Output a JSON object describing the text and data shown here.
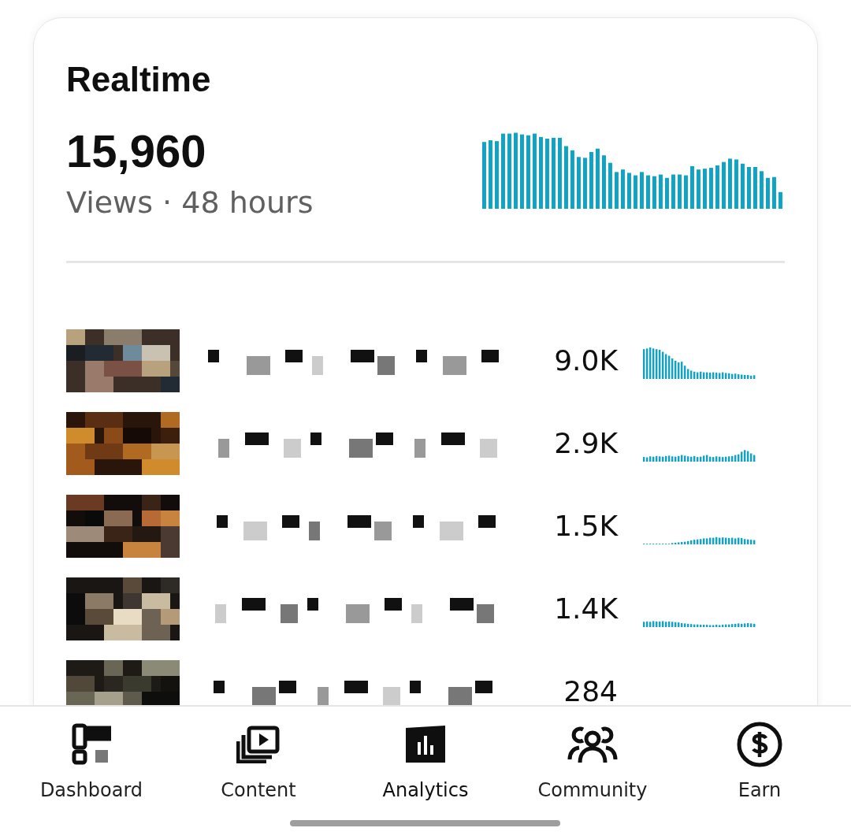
{
  "card": {
    "title": "Realtime",
    "total": "15,960",
    "caption": "Views · 48 hours"
  },
  "videos": [
    {
      "kind": "picture",
      "views": "9.0K"
    },
    {
      "kind": "picture",
      "views": "2.9K"
    },
    {
      "kind": "picture",
      "views": "1.5K"
    },
    {
      "kind": "picture",
      "views": "1.4K"
    },
    {
      "kind": "picture",
      "views": "284"
    }
  ],
  "nav": [
    {
      "label": "Dashboard",
      "selected": false
    },
    {
      "label": "Content",
      "selected": false
    },
    {
      "label": "Analytics",
      "selected": true
    },
    {
      "label": "Community",
      "selected": false
    },
    {
      "label": "Earn",
      "selected": false
    }
  ]
}
